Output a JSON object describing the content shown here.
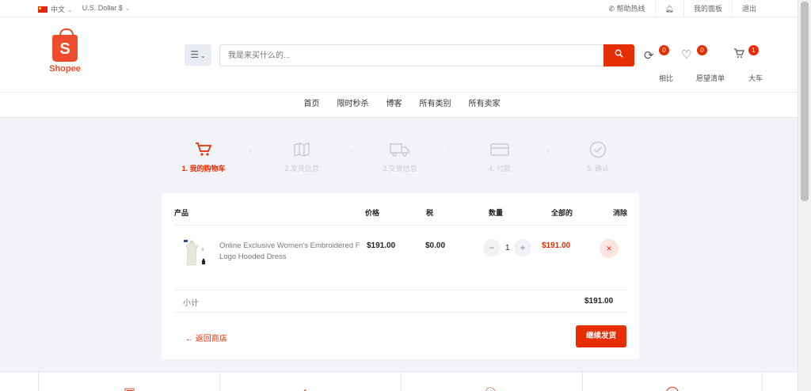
{
  "topbar": {
    "language": "中文",
    "currency": "U.S. Dollar $",
    "helpline": "帮助热线",
    "dashboard": "我的面板",
    "logout": "退出"
  },
  "header": {
    "logo_text": "Shopee",
    "search_placeholder": "我是来买什么的...",
    "compare_label": "相比",
    "compare_count": "0",
    "wishlist_label": "愿望清单",
    "wishlist_count": "0",
    "cart_label": "大车",
    "cart_count": "1"
  },
  "nav": [
    "首页",
    "限时秒杀",
    "博客",
    "所有类别",
    "所有卖家"
  ],
  "steps": [
    {
      "label": "1. 我的购物车",
      "icon": "cart-icon",
      "active": true
    },
    {
      "label": "2.发货信息",
      "icon": "map-icon",
      "active": false
    },
    {
      "label": "3.交货信息",
      "icon": "truck-icon",
      "active": false
    },
    {
      "label": "4. 付款",
      "icon": "credit-card-icon",
      "active": false
    },
    {
      "label": "5. 确认",
      "icon": "check-circle-icon",
      "active": false
    }
  ],
  "cart": {
    "headers": {
      "product": "产品",
      "price": "价格",
      "tax": "税",
      "quantity": "数量",
      "total": "全部的",
      "remove": "消除"
    },
    "items": [
      {
        "name": "Online Exclusive Women's Embroidered F Logo Hooded Dress",
        "price": "$191.00",
        "tax": "$0.00",
        "quantity": "1",
        "total": "$191.00"
      }
    ],
    "subtotal_label": "小计",
    "subtotal_value": "$191.00",
    "back_label": "← 返回商店",
    "continue_label": "继续发货"
  },
  "colors": {
    "accent": "#e62e04",
    "brand": "#ee4d2d",
    "background": "#f2f3f8"
  }
}
